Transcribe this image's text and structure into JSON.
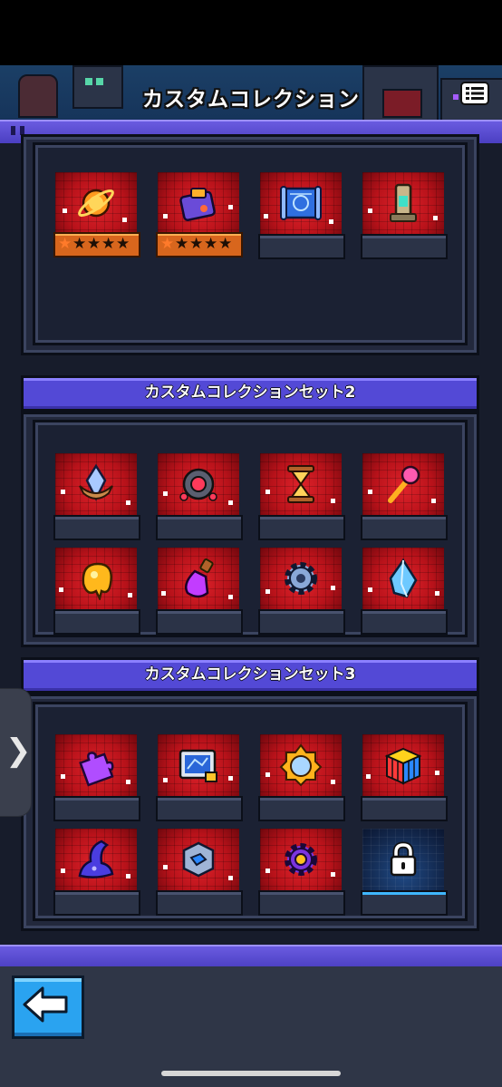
{
  "header": {
    "title": "カスタムコレクション",
    "menu_icon": "list-menu-icon"
  },
  "sets": [
    {
      "title": "",
      "items": [
        {
          "icon": "planet-ring-icon",
          "stars": 5,
          "star_glyph": "★",
          "locked": false
        },
        {
          "icon": "gadget-device-icon",
          "stars": 5,
          "star_glyph": "★",
          "locked": false
        },
        {
          "icon": "blueprint-scroll-icon",
          "stars": 0,
          "locked": false
        },
        {
          "icon": "lamp-tower-icon",
          "stars": 0,
          "locked": false
        }
      ]
    },
    {
      "title": "カスタムコレクションセット2",
      "items": [
        {
          "icon": "crystal-crown-icon",
          "locked": false
        },
        {
          "icon": "robot-eye-orb-icon",
          "locked": false
        },
        {
          "icon": "hourglass-icon",
          "locked": false
        },
        {
          "icon": "magic-staff-icon",
          "locked": false
        },
        {
          "icon": "slime-blob-icon",
          "locked": false
        },
        {
          "icon": "potion-bottle-icon",
          "locked": false
        },
        {
          "icon": "gear-icon",
          "locked": false
        },
        {
          "icon": "ice-crystal-icon",
          "locked": false
        }
      ]
    },
    {
      "title": "カスタムコレクションセット3",
      "items": [
        {
          "icon": "puzzle-piece-icon",
          "locked": false
        },
        {
          "icon": "circuit-board-icon",
          "locked": false
        },
        {
          "icon": "golden-mirror-icon",
          "locked": false
        },
        {
          "icon": "rubiks-cube-icon",
          "locked": false
        },
        {
          "icon": "wizard-hat-icon",
          "locked": false
        },
        {
          "icon": "metal-cube-icon",
          "locked": false
        },
        {
          "icon": "purple-gear-icon",
          "locked": false
        },
        {
          "icon": "padlock-icon",
          "locked": true
        }
      ]
    }
  ],
  "navigation": {
    "side_tab_glyph": "❯",
    "back_icon": "back-arrow-icon"
  },
  "colors": {
    "accent_purple": "#5349d6",
    "slot_red": "#b3101a",
    "back_blue": "#2aa3f0"
  }
}
